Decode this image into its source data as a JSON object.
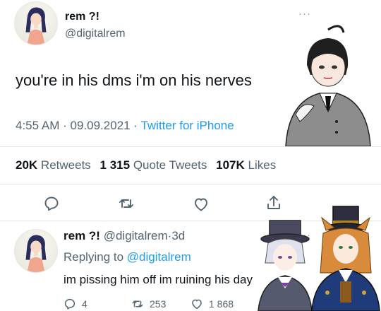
{
  "main_tweet": {
    "display_name": "rem ?!",
    "handle": "@digitalrem",
    "text": "you're in his dms i'm on his nerves",
    "time": "4:55 AM",
    "dot": "·",
    "date": "09.09.2021",
    "source": "Twitter for iPhone",
    "stats": {
      "retweets_count": "20K",
      "retweets_label": "Retweets",
      "quote_count": "1 315",
      "quote_label": "Quote Tweets",
      "likes_count": "107K",
      "likes_label": "Likes"
    },
    "icons": {
      "more": "more-horizontal-icon",
      "reply": "reply-icon",
      "retweet": "retweet-icon",
      "like": "heart-icon",
      "share": "share-icon"
    }
  },
  "reply_tweet": {
    "display_name": "rem ?!",
    "handle": "@digitalrem",
    "dot": "·",
    "age": "3d",
    "replying_label": "Replying to",
    "replying_to": "@digitalrem",
    "text": "im pissing him off im ruining his day",
    "reply_count": "4",
    "retweet_count": "253",
    "like_count": "1 868"
  },
  "colors": {
    "text": "#0f1419",
    "secondary": "#536471",
    "link": "#1d9bf0",
    "divider": "#e3e7ea"
  }
}
